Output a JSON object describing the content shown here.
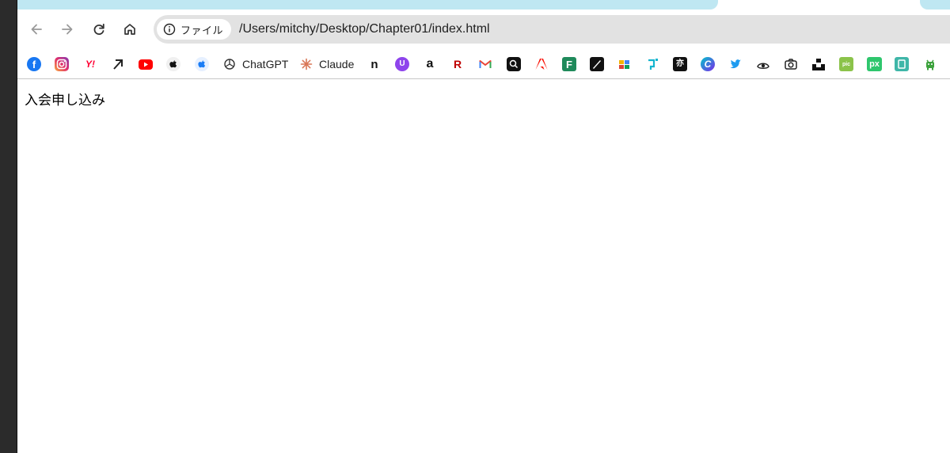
{
  "browser": {
    "url_chip_label": "ファイル",
    "url": "/Users/mitchy/Desktop/Chapter01/index.html"
  },
  "bookmarks": [
    {
      "name": "facebook",
      "label": ""
    },
    {
      "name": "instagram",
      "label": ""
    },
    {
      "name": "yahoo",
      "label": "Y!"
    },
    {
      "name": "x",
      "label": ""
    },
    {
      "name": "youtube",
      "label": ""
    },
    {
      "name": "apple",
      "label": ""
    },
    {
      "name": "apple-dev",
      "label": ""
    },
    {
      "name": "chatgpt",
      "label": "ChatGPT"
    },
    {
      "name": "claude",
      "label": "Claude"
    },
    {
      "name": "note",
      "label": "n"
    },
    {
      "name": "bookmark-purple",
      "label": ""
    },
    {
      "name": "amazon",
      "label": "a"
    },
    {
      "name": "rakuten",
      "label": "R"
    },
    {
      "name": "gmail",
      "label": "M"
    },
    {
      "name": "bookmark-dark-1",
      "label": ""
    },
    {
      "name": "adobe",
      "label": ""
    },
    {
      "name": "freee",
      "label": "F"
    },
    {
      "name": "bookmark-dark-2",
      "label": ""
    },
    {
      "name": "bookmark-colorful",
      "label": ""
    },
    {
      "name": "bookmark-cyan",
      "label": ""
    },
    {
      "name": "bookmark-dark-3",
      "label": ""
    },
    {
      "name": "canva",
      "label": "C"
    },
    {
      "name": "twitter",
      "label": ""
    },
    {
      "name": "bookmark-eye",
      "label": ""
    },
    {
      "name": "camera",
      "label": ""
    },
    {
      "name": "unsplash",
      "label": ""
    },
    {
      "name": "bookmark-green",
      "label": "pic"
    },
    {
      "name": "pixabay",
      "label": "px"
    },
    {
      "name": "bookmark-teal",
      "label": ""
    },
    {
      "name": "bookmark-android",
      "label": ""
    }
  ],
  "page": {
    "heading": "入会申し込み"
  },
  "colors": {
    "tab_accent": "#bfe7f2",
    "omnibox_bg": "#e2e2e2"
  }
}
